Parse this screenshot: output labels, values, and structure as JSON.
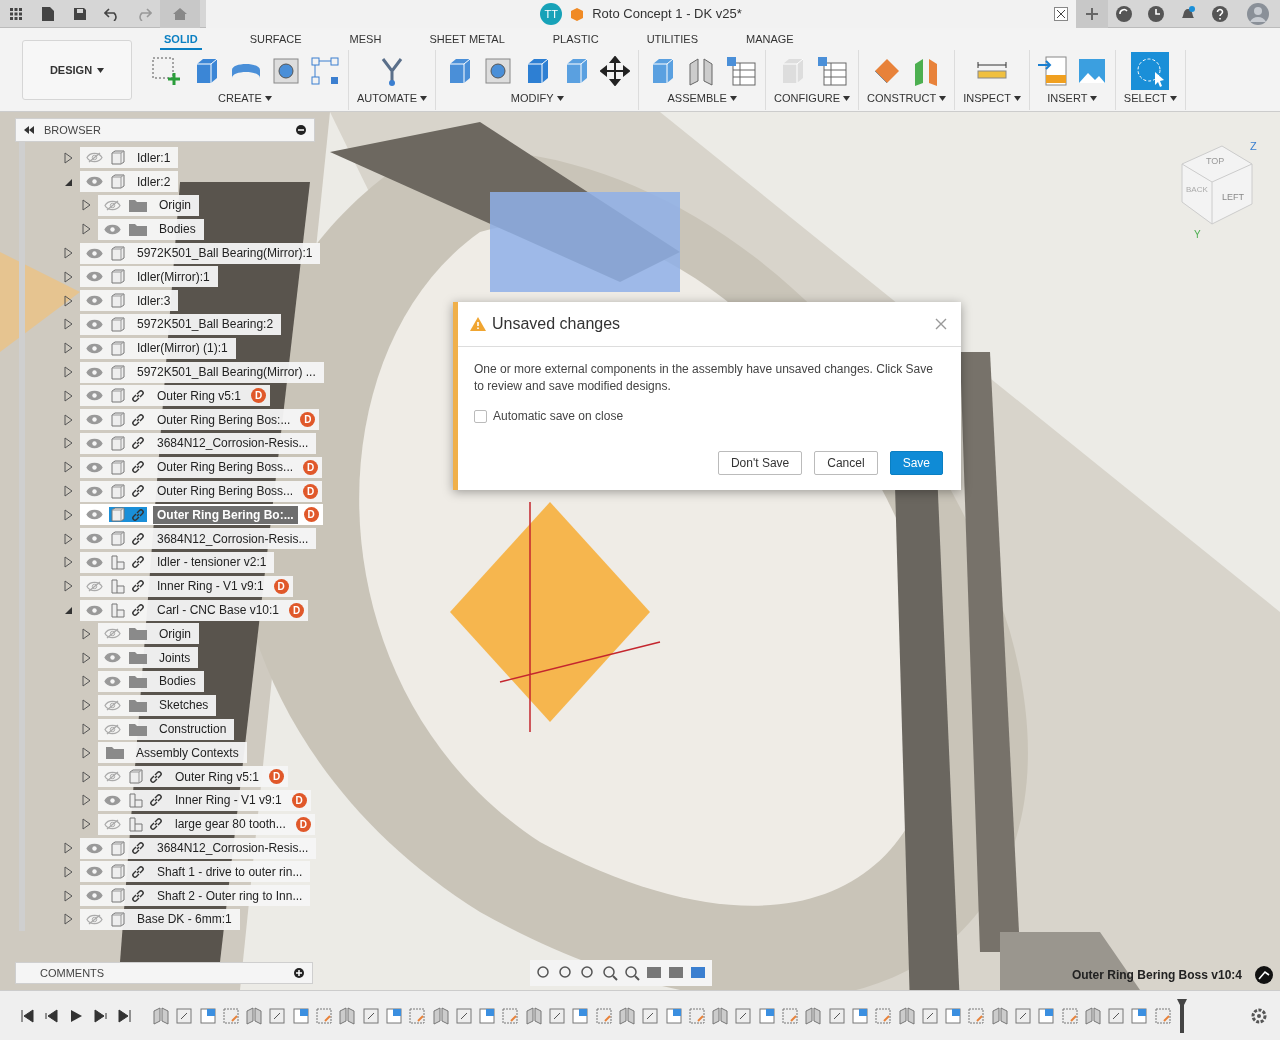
{
  "title_bar": {
    "avatar": "TT",
    "document_title": "Roto Concept 1 - DK v25*"
  },
  "workspace": {
    "label": "DESIGN"
  },
  "tabs": [
    {
      "label": "SOLID",
      "selected": true
    },
    {
      "label": "SURFACE",
      "selected": false
    },
    {
      "label": "MESH",
      "selected": false
    },
    {
      "label": "SHEET METAL",
      "selected": false
    },
    {
      "label": "PLASTIC",
      "selected": false
    },
    {
      "label": "UTILITIES",
      "selected": false
    },
    {
      "label": "MANAGE",
      "selected": false
    }
  ],
  "tool_groups": [
    {
      "label": "CREATE"
    },
    {
      "label": "AUTOMATE"
    },
    {
      "label": "MODIFY"
    },
    {
      "label": "ASSEMBLE"
    },
    {
      "label": "CONFIGURE"
    },
    {
      "label": "CONSTRUCT"
    },
    {
      "label": "INSPECT"
    },
    {
      "label": "INSERT"
    },
    {
      "label": "SELECT"
    }
  ],
  "browser": {
    "title": "BROWSER",
    "items": [
      {
        "label": "Idler:1",
        "kind": "component",
        "visible": false,
        "expanded": false,
        "linked": false,
        "selected": false
      },
      {
        "label": "Idler:2",
        "kind": "component",
        "visible": true,
        "expanded": true,
        "linked": false,
        "selected": false,
        "children": [
          {
            "label": "Origin",
            "kind": "folder",
            "visible": false,
            "expanded": false,
            "linked": false,
            "selected": false
          },
          {
            "label": "Bodies",
            "kind": "folder",
            "visible": true,
            "expanded": false,
            "linked": false,
            "selected": false
          }
        ]
      },
      {
        "label": "5972K501_Ball Bearing(Mirror):1",
        "kind": "component",
        "visible": true,
        "expanded": false,
        "linked": false,
        "selected": false
      },
      {
        "label": "Idler(Mirror):1",
        "kind": "component",
        "visible": true,
        "expanded": false,
        "linked": false,
        "selected": false
      },
      {
        "label": "Idler:3",
        "kind": "component",
        "visible": true,
        "expanded": false,
        "linked": false,
        "selected": false
      },
      {
        "label": "5972K501_Ball Bearing:2",
        "kind": "component",
        "visible": true,
        "expanded": false,
        "linked": false,
        "selected": false
      },
      {
        "label": "Idler(Mirror) (1):1",
        "kind": "component",
        "visible": true,
        "expanded": false,
        "linked": false,
        "selected": false
      },
      {
        "label": "5972K501_Ball Bearing(Mirror) ...",
        "kind": "component",
        "visible": true,
        "expanded": false,
        "linked": false,
        "selected": false
      },
      {
        "label": "Outer Ring v5:1",
        "kind": "component",
        "visible": true,
        "expanded": false,
        "linked": true,
        "selected": false,
        "badge": "D"
      },
      {
        "label": "Outer Ring Bering Bos:...",
        "kind": "component",
        "visible": true,
        "expanded": false,
        "linked": true,
        "selected": false,
        "badge": "D"
      },
      {
        "label": "3684N12_Corrosion-Resis...",
        "kind": "component",
        "visible": true,
        "expanded": false,
        "linked": true,
        "selected": false
      },
      {
        "label": "Outer Ring Bering Boss...",
        "kind": "component",
        "visible": true,
        "expanded": false,
        "linked": true,
        "selected": false,
        "badge": "D"
      },
      {
        "label": "Outer Ring Bering Boss...",
        "kind": "component",
        "visible": true,
        "expanded": false,
        "linked": true,
        "selected": false,
        "badge": "D"
      },
      {
        "label": "Outer Ring Bering Bo:...",
        "kind": "component",
        "visible": true,
        "expanded": false,
        "linked": true,
        "selected": true,
        "badge": "D"
      },
      {
        "label": "3684N12_Corrosion-Resis...",
        "kind": "component",
        "visible": true,
        "expanded": false,
        "linked": true,
        "selected": false
      },
      {
        "label": "Idler - tensioner v2:1",
        "kind": "assembly",
        "visible": true,
        "expanded": false,
        "linked": true,
        "selected": false
      },
      {
        "label": "Inner Ring - V1 v9:1",
        "kind": "assembly",
        "visible": false,
        "expanded": false,
        "linked": true,
        "selected": false,
        "badge": "D"
      },
      {
        "label": "Carl - CNC Base v10:1",
        "kind": "assembly",
        "visible": true,
        "expanded": true,
        "linked": true,
        "selected": false,
        "badge": "D",
        "children": [
          {
            "label": "Origin",
            "kind": "folder",
            "visible": false,
            "expanded": false,
            "linked": false,
            "selected": false
          },
          {
            "label": "Joints",
            "kind": "folder",
            "visible": true,
            "expanded": false,
            "linked": false,
            "selected": false
          },
          {
            "label": "Bodies",
            "kind": "folder",
            "visible": true,
            "expanded": false,
            "linked": false,
            "selected": false
          },
          {
            "label": "Sketches",
            "kind": "folder",
            "visible": false,
            "expanded": false,
            "linked": false,
            "selected": false
          },
          {
            "label": "Construction",
            "kind": "folder",
            "visible": false,
            "expanded": false,
            "linked": false,
            "selected": false
          },
          {
            "label": "Assembly Contexts",
            "kind": "folder",
            "expanded": false,
            "linked": false,
            "selected": false
          },
          {
            "label": "Outer Ring v5:1",
            "kind": "component",
            "visible": false,
            "expanded": false,
            "linked": true,
            "selected": false,
            "badge": "D"
          },
          {
            "label": "Inner Ring - V1 v9:1",
            "kind": "assembly",
            "visible": true,
            "expanded": false,
            "linked": true,
            "selected": false,
            "badge": "D"
          },
          {
            "label": "large gear 80 tooth...",
            "kind": "assembly",
            "visible": false,
            "expanded": false,
            "linked": true,
            "selected": false,
            "badge": "D"
          }
        ]
      },
      {
        "label": "3684N12_Corrosion-Resis...",
        "kind": "component",
        "visible": true,
        "expanded": false,
        "linked": true,
        "selected": false
      },
      {
        "label": "Shaft 1 - drive to outer rin...",
        "kind": "component",
        "visible": true,
        "expanded": false,
        "linked": true,
        "selected": false
      },
      {
        "label": "Shaft 2 - Outer ring to Inn...",
        "kind": "component",
        "visible": true,
        "expanded": false,
        "linked": true,
        "selected": false
      },
      {
        "label": "Base DK - 6mm:1",
        "kind": "component",
        "visible": false,
        "expanded": false,
        "linked": false,
        "selected": false
      }
    ]
  },
  "comments": {
    "title": "COMMENTS"
  },
  "viewcube": {
    "faces": [
      "TOP",
      "BACK",
      "LEFT"
    ],
    "axes": [
      "Z",
      "Y"
    ]
  },
  "dialog": {
    "title": "Unsaved changes",
    "message": "One or more external components in the assembly have unsaved changes. Click Save to review and save modified designs.",
    "checkbox": {
      "label": "Automatic save on close",
      "checked": false
    },
    "buttons": [
      {
        "label": "Don't Save",
        "primary": false
      },
      {
        "label": "Cancel",
        "primary": false
      },
      {
        "label": "Save",
        "primary": true
      }
    ]
  },
  "status": {
    "text": "Outer Ring Bering Boss v10:4"
  }
}
